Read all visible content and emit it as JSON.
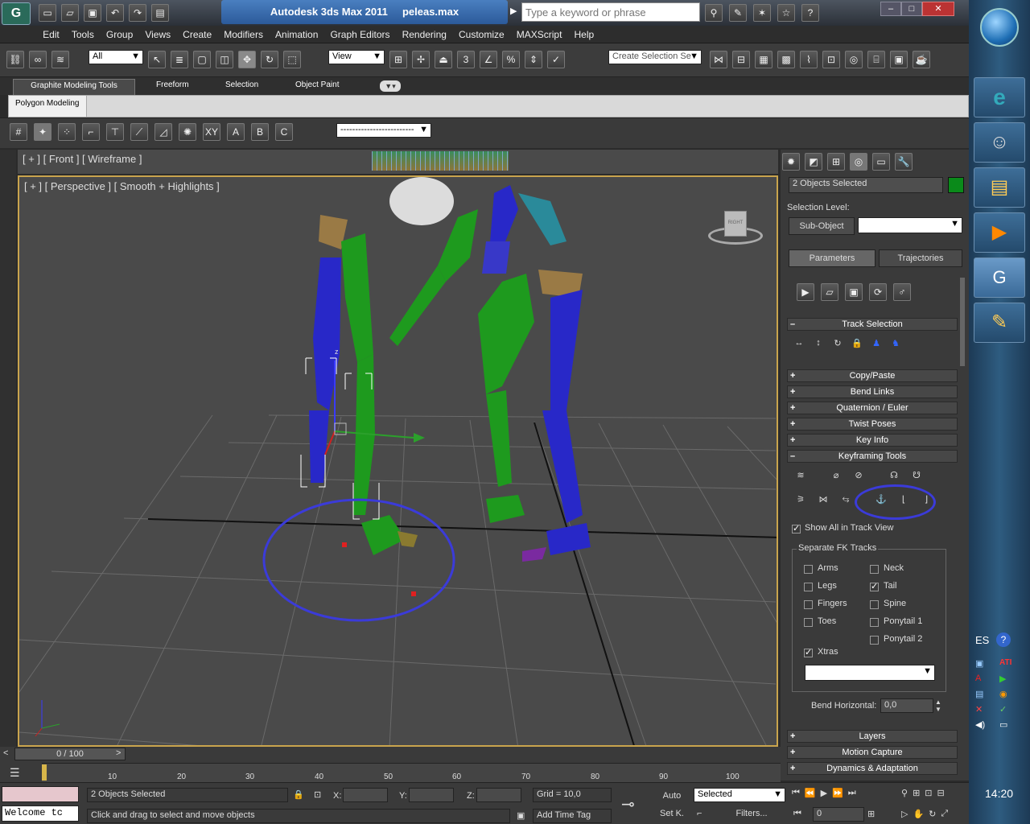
{
  "window": {
    "title": "Autodesk 3ds Max  2011",
    "file": "peleas.max",
    "search_placeholder": "Type a keyword or phrase"
  },
  "menu": [
    "Edit",
    "Tools",
    "Group",
    "Views",
    "Create",
    "Modifiers",
    "Animation",
    "Graph Editors",
    "Rendering",
    "Customize",
    "MAXScript",
    "Help"
  ],
  "toolbar": {
    "selection_filter": "All",
    "ref_coord": "View",
    "named_selection": "Create Selection Se"
  },
  "ribbon": {
    "tabs": [
      "Graphite Modeling Tools",
      "Freeform",
      "Selection",
      "Object Paint"
    ],
    "active_panel": "Polygon Modeling"
  },
  "snapbar": {
    "dropdown": "-------------------------"
  },
  "viewports": {
    "top_label": "[ + ] [ Front ] [ Wireframe ]",
    "main_label": "[ + ] [ Perspective ] [ Smooth + Highlights ]",
    "viewcube_label": "RIGHT"
  },
  "command_panel": {
    "selection_name": "2 Objects Selected",
    "selection_color": "#0a8a1a",
    "selection_level_label": "Selection Level:",
    "sub_object_button": "Sub-Object",
    "tabs": [
      "Parameters",
      "Trajectories"
    ],
    "rollouts_top": [
      {
        "sign": "–",
        "label": "Track Selection"
      },
      {
        "sign": "+",
        "label": "Copy/Paste"
      },
      {
        "sign": "+",
        "label": "Bend Links"
      },
      {
        "sign": "+",
        "label": "Quaternion / Euler"
      },
      {
        "sign": "+",
        "label": "Twist Poses"
      },
      {
        "sign": "+",
        "label": "Key Info"
      },
      {
        "sign": "–",
        "label": "Keyframing Tools"
      }
    ],
    "show_all_label": "Show All in Track View",
    "separate_fk_label": "Separate FK Tracks",
    "fk_tracks": {
      "left": [
        {
          "label": "Arms",
          "checked": false
        },
        {
          "label": "Legs",
          "checked": false
        },
        {
          "label": "Fingers",
          "checked": false
        },
        {
          "label": "Toes",
          "checked": false
        }
      ],
      "right": [
        {
          "label": "Neck",
          "checked": false
        },
        {
          "label": "Tail",
          "checked": true
        },
        {
          "label": "Spine",
          "checked": false
        },
        {
          "label": "Ponytail 1",
          "checked": false
        },
        {
          "label": "Ponytail 2",
          "checked": false
        }
      ],
      "xtras": {
        "label": "Xtras",
        "checked": true
      }
    },
    "bend_horizontal_label": "Bend Horizontal:",
    "bend_horizontal_value": "0,0",
    "rollouts_bottom": [
      {
        "sign": "+",
        "label": "Layers"
      },
      {
        "sign": "+",
        "label": "Motion Capture"
      },
      {
        "sign": "+",
        "label": "Dynamics & Adaptation"
      }
    ]
  },
  "timeline": {
    "frame": "0 / 100",
    "ticks": [
      "10",
      "20",
      "30",
      "40",
      "50",
      "60",
      "70",
      "80",
      "90",
      "100"
    ]
  },
  "status": {
    "maxscript": "Welcome tc",
    "selected": "2 Objects Selected",
    "prompt": "Click and drag to select and move objects",
    "x_label": "X:",
    "y_label": "Y:",
    "z_label": "Z:",
    "grid": "Grid = 10,0",
    "add_time_tag": "Add Time Tag",
    "auto": "Auto",
    "set_key": "Set K.",
    "key_filter": "Selected",
    "filters": "Filters...",
    "frame_field": "0"
  },
  "taskbar": {
    "lang": "ES",
    "clock": "14:20"
  }
}
